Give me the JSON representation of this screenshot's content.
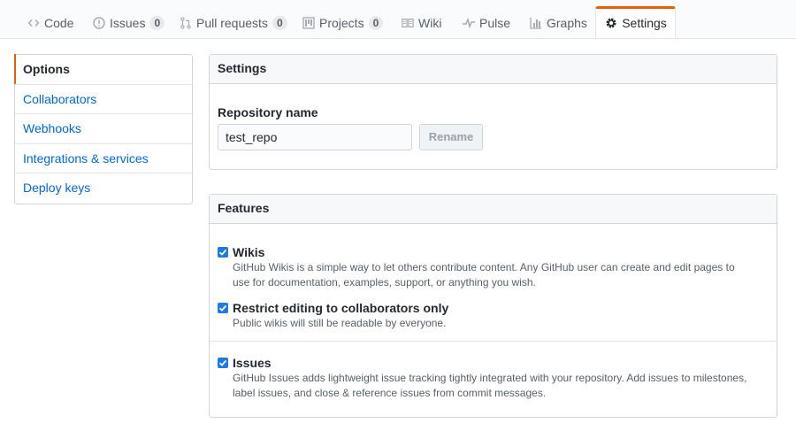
{
  "tabs": [
    {
      "label": "Code",
      "icon": "code-icon"
    },
    {
      "label": "Issues",
      "icon": "issue-opened-icon",
      "count": "0"
    },
    {
      "label": "Pull requests",
      "icon": "git-pull-request-icon",
      "count": "0"
    },
    {
      "label": "Projects",
      "icon": "project-icon",
      "count": "0"
    },
    {
      "label": "Wiki",
      "icon": "book-icon"
    },
    {
      "label": "Pulse",
      "icon": "pulse-icon"
    },
    {
      "label": "Graphs",
      "icon": "graph-icon"
    },
    {
      "label": "Settings",
      "icon": "gear-icon",
      "selected": true
    }
  ],
  "menu": {
    "items": [
      "Options",
      "Collaborators",
      "Webhooks",
      "Integrations & services",
      "Deploy keys"
    ],
    "selected": "Options"
  },
  "settings": {
    "header": "Settings",
    "repo_name_label": "Repository name",
    "repo_name_value": "test_repo",
    "rename_button": "Rename"
  },
  "features": {
    "header": "Features",
    "items": [
      {
        "title": "Wikis",
        "checked": true,
        "desc": "GitHub Wikis is a simple way to let others contribute content. Any GitHub user can create and edit pages to use for documentation, examples, support, or anything you wish."
      },
      {
        "title": "Restrict editing to collaborators only",
        "checked": true,
        "desc": "Public wikis will still be readable by everyone."
      },
      {
        "title": "Issues",
        "checked": true,
        "desc": "GitHub Issues adds lightweight issue tracking tightly integrated with your repository. Add issues to milestones, label issues, and close & reference issues from commit messages."
      }
    ]
  },
  "colors": {
    "accent": "#e36209",
    "link": "#0366d6",
    "checkbox": "#1f7ae0"
  }
}
